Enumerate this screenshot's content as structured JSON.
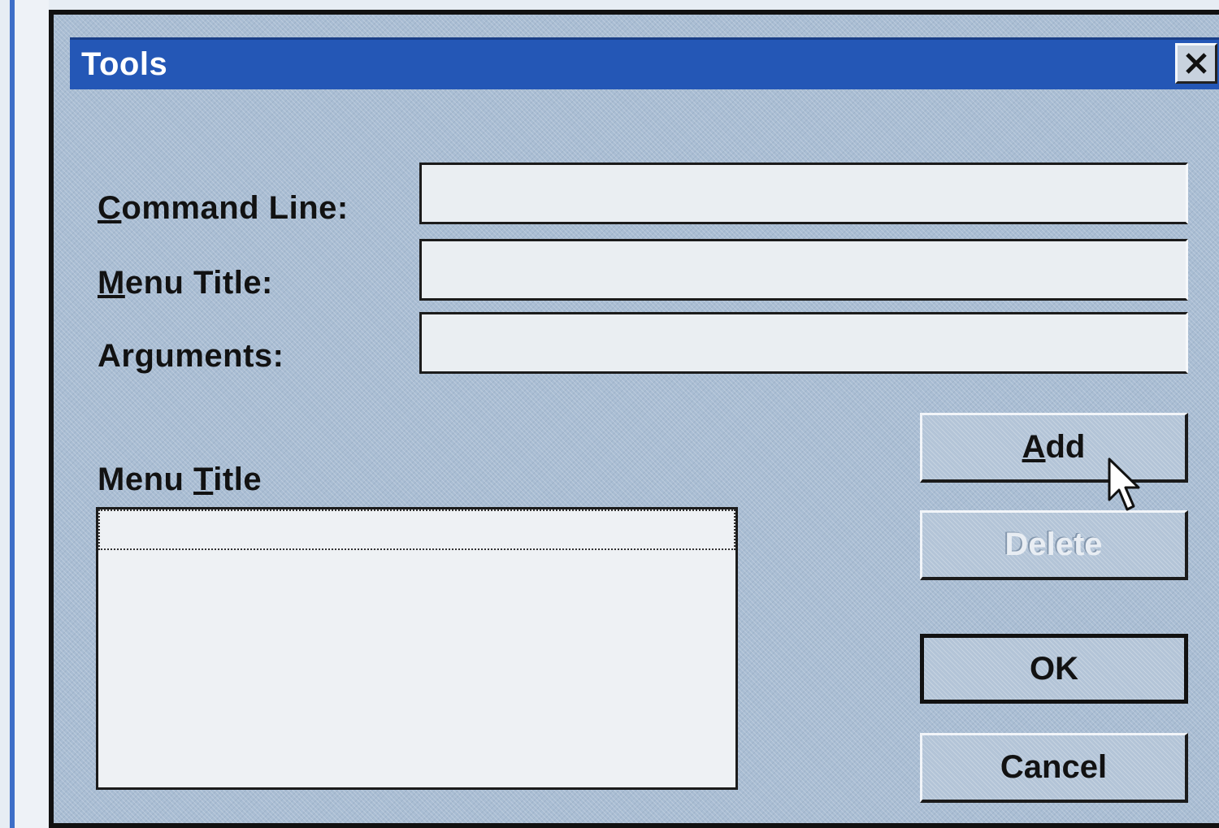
{
  "dialog": {
    "title": "Tools",
    "close_label": "Close"
  },
  "form": {
    "command_line": {
      "label": "Command Line:",
      "value": ""
    },
    "menu_title": {
      "label": "Menu Title:",
      "value": ""
    },
    "arguments": {
      "label": "Arguments:",
      "value": ""
    }
  },
  "list": {
    "label": "Menu Title",
    "items": []
  },
  "buttons": {
    "add": "Add",
    "delete": "Delete",
    "ok": "OK",
    "cancel": "Cancel"
  },
  "icons": {
    "close": "close-icon",
    "cursor": "mouse-pointer-icon"
  },
  "colors": {
    "title_bar": "#2457b6",
    "dialog_face": "#a9bdd3",
    "field_bg": "#eaeef2"
  }
}
